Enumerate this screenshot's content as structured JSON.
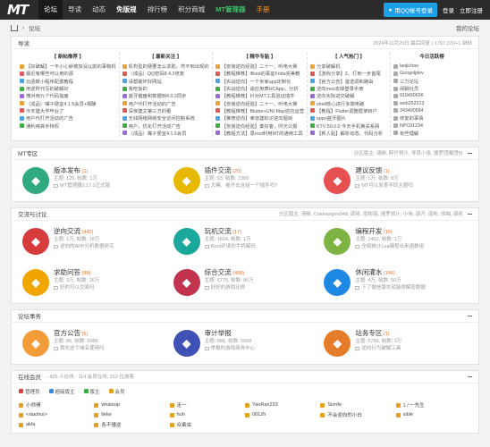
{
  "topbar": {
    "logo": "MT",
    "nav": [
      "论坛",
      "导读",
      "动态",
      "免版规",
      "排行榜",
      "积分商城",
      "MT管理器",
      "手册"
    ],
    "qq_login": "用QQ帐号登录",
    "login": "登录",
    "register": "立即注册"
  },
  "crumb": {
    "label": "论坛",
    "right": "我的论坛"
  },
  "guide": {
    "title": "导读",
    "meta": "2024年11月20日 最后回复 | 1797 (15)+1 新帖",
    "columns": [
      {
        "title": "【 新帖推荐 】",
        "items": [
          "【好破解】一不小心就被加没以前的事物机",
          "最近有哪些可以用的源",
          "云函数小程序配置教程",
          "用逆时代写的破解好",
          "懂对用九个代码指南",
          "（成品）嘴子便宜4.1.5会员+报酬",
          "今天建大学毕业了",
          "用户代打开活动的广告",
          "通利用高手特权"
        ]
      },
      {
        "title": "【 最新关注 】",
        "items": [
          "机构型的便要怎么求助，然不到出现的",
          "（成品）QQ密码8.4.2修复",
          "请帮破坏好网站",
          "我吃饭的",
          "蓝牙键盘和数据到4.0.2同步",
          "用户代打开活动的广告",
          "深夜建文第三方的看",
          "无线网络网络安全访问控制系统",
          "用户，优化打开活动广告",
          "（成品）嘴子便宜4.1.5会员"
        ]
      },
      {
        "title": "【 精华专贴 】",
        "items": [
          "【安装逆向经验】二十一、听电大赛",
          "【教程推荐】iBoot的事宜Frida完美教",
          "【实战逆向】一个米家app定制化",
          "【实战逆向】适应用表HCApp，分析",
          "【教程推荐】针对MT工具验证插件",
          "【安装逆向经验】二十一、听电大赛",
          "【教程推荐】Blutter+UNI Map逆向运营",
          "【推荐逆向】某道建标识逆向题目",
          "【安装逆向经验】秦好客，时光公报",
          "【教程方法】思root利用MT的通用工具"
        ]
      },
      {
        "title": "【 人气热门 】",
        "items": [
          "分享破解机",
          "【游戏分享】2、打到一步首尾",
          "【官方公告】首选调和路由",
          "逆向mos去掉登录手册",
          "逆向实际进交破解",
          "shell核心进行多端电路",
          "【教程】Flutter调整框架转户",
          "oppo蓝牙图片",
          "KTV 50.0.0 今天手机换关系网",
          "【新人贴】解析动态、代码分析"
        ]
      },
      {
        "title": "今日活跃榜",
        "items": [
          "laojichao",
          "Googoljdev",
          "三力论坛",
          "闲聊社员",
          "919490656",
          "web252213",
          "343400584",
          "修复的事情",
          "NPC01234",
          "有些理解"
        ]
      }
    ]
  },
  "sections": [
    {
      "title": "MT专区",
      "sub": "分区版主: 清晰, 醉仔领汁, 寻觅小张, 搜罗团聚团伙",
      "forums": [
        {
          "name": "版本发布",
          "count": "(1)",
          "stat": "主题: 120, 帖数: 1万",
          "last": "MT管理器2.17.0正式版",
          "color": "#2faa7f"
        },
        {
          "name": "插件交流",
          "count": "(20)",
          "stat": "主题: 53, 帖数: 2389",
          "last": "大模、被开去这组一个插件吗?",
          "color": "#e6b800"
        },
        {
          "name": "建议反馈",
          "count": "(1)",
          "stat": "主题: 1万, 帖数: 8万",
          "last": "MT可以发表不同主题吗",
          "color": "#e65050"
        }
      ]
    },
    {
      "title": "交流与讨论",
      "sub": "分区版主: 清晰, Cokkepigen048, 邵彬, 雨彬铭, 搜罗领汁, 小伟, 邵开, 邵彬, 领袖, 邵彬",
      "forums": [
        {
          "name": "逆向交流",
          "count": "(442)",
          "stat": "主题: 1万, 帖数: 18万",
          "last": "逆向的APP分析数据研究",
          "color": "#d63c3c"
        },
        {
          "name": "玩机交流",
          "count": "(17)",
          "stat": "主题: 1654, 帖数: 1万",
          "last": "Root环境的手机解码",
          "color": "#1ba89c"
        },
        {
          "name": "编程开发",
          "count": "(19)",
          "stat": "主题: 1462, 帖数: 1万",
          "last": "全局统计Lua编程出来函数组",
          "color": "#7cb342"
        },
        {
          "name": "求助问答",
          "count": "(88)",
          "stat": "主题: 3万, 帖数: 26万",
          "last": "好的可以交易吗",
          "color": "#f0a500"
        },
        {
          "name": "综合交流",
          "count": "(458)",
          "stat": "主题: 6775, 帖数: 80万",
          "last": "好好的游戏比例",
          "color": "#c2334e"
        },
        {
          "name": "休闲灌水",
          "count": "(146)",
          "stat": "主题: 4万, 帖数: 50万",
          "last": "下了微信版本就能得解密数据",
          "color": "#1e88e5"
        }
      ]
    },
    {
      "title": "论坛事务",
      "sub": "",
      "forums": [
        {
          "name": "官方公告",
          "count": "(5)",
          "stat": "主题: 86, 帖数: 6988",
          "last": "首先这个域名使用吗",
          "color": "#f39c3a"
        },
        {
          "name": "审计举报",
          "count": "",
          "stat": "主题: 886, 帖数: 5008",
          "last": "举报的游戏商务中心",
          "color": "#3f51b5"
        },
        {
          "name": "站务专区",
          "count": "(1)",
          "stat": "主题: 5786, 帖数: 3万",
          "last": "逆向行为破解工具",
          "color": "#e57c2a"
        }
      ]
    }
  ],
  "online": {
    "title": "在线会员",
    "sub": "- 426 人在线 - 114 会员在线, 312 位游客",
    "legend": [
      "管理员",
      "超级版主",
      "版主",
      "会员"
    ],
    "legend_colors": [
      "#e04040",
      "#3a8ee6",
      "#3fae45",
      "#e4a11b"
    ],
    "users": [
      "小师傅",
      "whatsup",
      "走一",
      "YanRan233",
      "Sionfe",
      "1 / 一先生",
      "<xiaohui>",
      "lleke",
      "huh",
      "0012h",
      "不会逆向的小白",
      "xible",
      "akfa",
      "各不懂逆",
      "众乘虫"
    ]
  }
}
